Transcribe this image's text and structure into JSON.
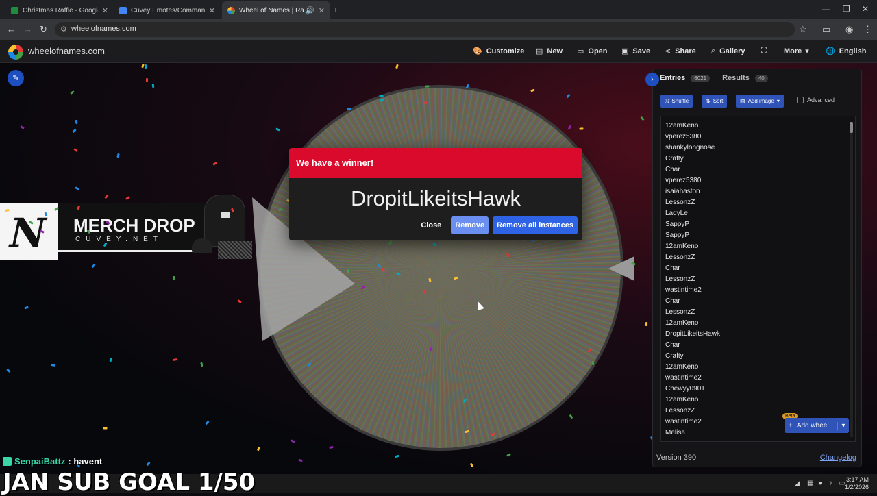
{
  "browser": {
    "tabs": [
      {
        "title": "Christmas Raffle - Google Shee",
        "favicon_color": "#1e8e3e",
        "active": false
      },
      {
        "title": "Cuvey Emotes/Commands - Go",
        "favicon_color": "#4285f4",
        "active": false
      },
      {
        "title": "Wheel of Names | Random",
        "favicon_color": "#e53935",
        "active": true
      }
    ],
    "url": "wheelofnames.com"
  },
  "header": {
    "site_name": "wheelofnames.com",
    "menu": {
      "customize": "Customize",
      "new": "New",
      "open": "Open",
      "save": "Save",
      "share": "Share",
      "gallery": "Gallery",
      "more": "More",
      "language": "English"
    }
  },
  "overlay": {
    "merch_title": "MERCH DROP",
    "merch_sub": "CUVEY.NET",
    "chat_user": "SenpaiBattz",
    "chat_message": ": havent",
    "sub_goal": "JAN SUB GOAL 1/50"
  },
  "dialog": {
    "header": "We have a winner!",
    "winner": "DropitLikeitsHawk",
    "close_label": "Close",
    "remove_label": "Remove",
    "remove_all_label": "Remove all instances"
  },
  "sidebar": {
    "entries_label": "Entries",
    "entries_count": "6021",
    "results_label": "Results",
    "results_count": "40",
    "shuffle": "Shuffle",
    "sort": "Sort",
    "add_image": "Add image",
    "advanced": "Advanced",
    "entries": [
      "12amKeno",
      "vperez5380",
      "shankylongnose",
      "Crafty",
      "Char",
      "vperez5380",
      "isaiahaston",
      "LessonzZ",
      "LadyLe",
      "SappyP",
      "SappyP",
      "12amKeno",
      "LessonzZ",
      "Char",
      "LessonzZ",
      "wastintime2",
      "Char",
      "LessonzZ",
      "12amKeno",
      "DropitLikeitsHawk",
      "Char",
      "Crafty",
      "12amKeno",
      "wastintime2",
      "Chewyy0901",
      "12amKeno",
      "LessonzZ",
      "wastintime2",
      "Melisa"
    ],
    "add_wheel": "Add wheel",
    "beta": "Beta",
    "version": "Version 390",
    "changelog": "Changelog"
  },
  "taskbar": {
    "time": "3:17 AM",
    "date": "1/2/2026"
  },
  "colors": {
    "accent_blue": "#2f63e6",
    "winner_red": "#d90a2c"
  }
}
